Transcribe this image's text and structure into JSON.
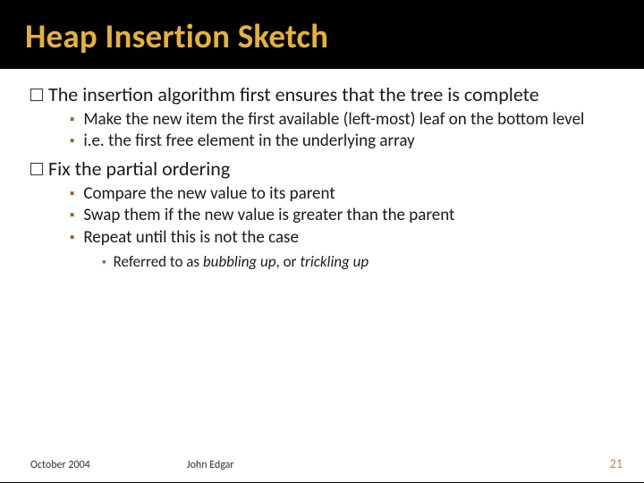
{
  "title": "Heap Insertion Sketch",
  "points": {
    "p1": "The insertion algorithm first ensures that the tree is complete",
    "p1_sub1": "Make the new item the first available (left-most) leaf on the bottom level",
    "p1_sub2": "i.e. the first free element in the underlying array",
    "p2": "Fix the partial ordering",
    "p2_sub1": "Compare the new value to its parent",
    "p2_sub2": "Swap them if the new value is greater than the parent",
    "p2_sub3": "Repeat until this is not the case",
    "p2_sub3_a_prefix": "Referred to as ",
    "p2_sub3_a_em1": "bubbling up",
    "p2_sub3_a_mid": ", or ",
    "p2_sub3_a_em2": "trickling up"
  },
  "footer": {
    "date": "October 2004",
    "author": "John Edgar",
    "page": "21"
  }
}
